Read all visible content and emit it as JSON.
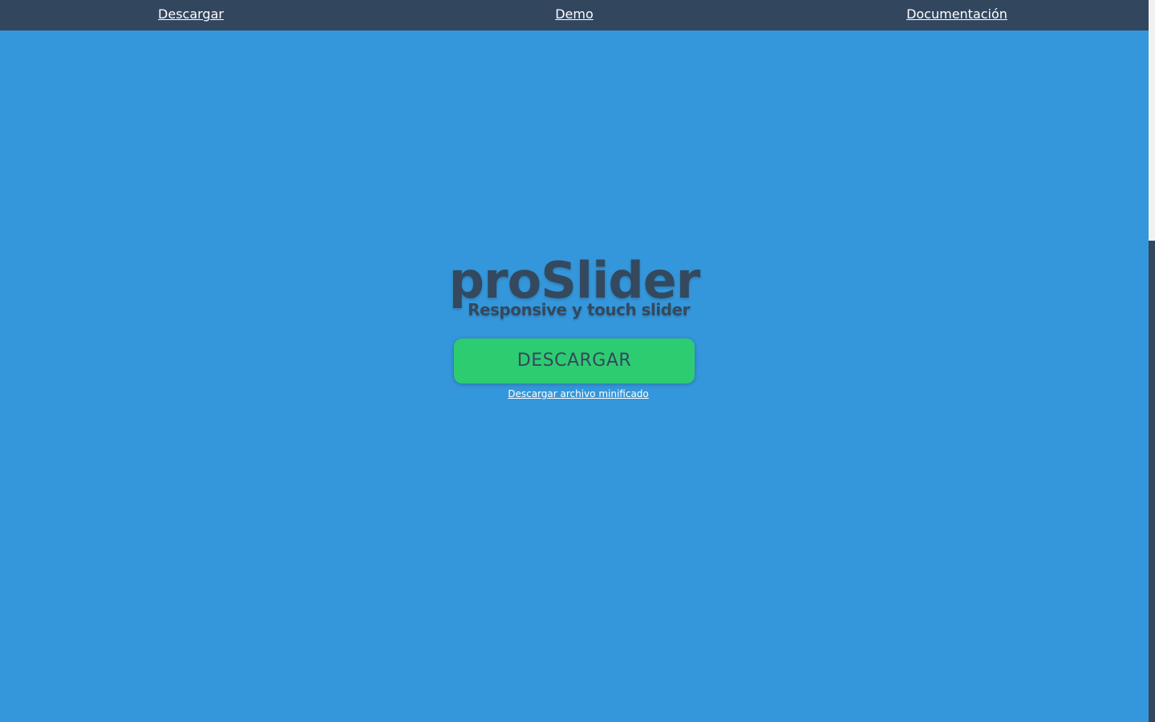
{
  "nav": {
    "items": [
      {
        "label": "Descargar"
      },
      {
        "label": "Demo"
      },
      {
        "label": "Documentación"
      }
    ]
  },
  "hero": {
    "logo_title": "proSlider",
    "logo_subtitle": "Responsive y touch slider",
    "download_button": "DESCARGAR",
    "minified_link": "Descargar archivo minificado"
  },
  "colors": {
    "background": "#3597db",
    "nav_background": "#32465e",
    "button_background": "#2ecc71",
    "logo_text": "#34495e",
    "link_text": "#ffffff"
  }
}
